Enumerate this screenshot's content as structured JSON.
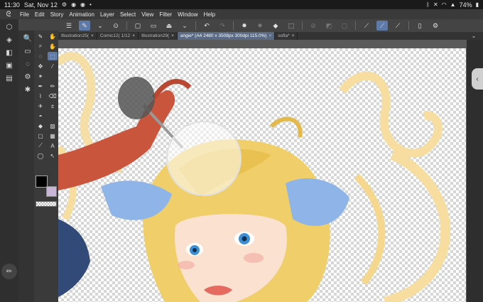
{
  "status_bar": {
    "time": "11:30",
    "date": "Sat, Nov 12",
    "battery": "74%",
    "left_icons": [
      "settings-gear-icon",
      "discord-icon",
      "discord-icon",
      "dot-icon"
    ],
    "right_icons": [
      "bluetooth-icon",
      "mute-icon",
      "wifi-icon",
      "signal-icon",
      "battery-icon"
    ]
  },
  "menu": {
    "items": [
      "File",
      "Edit",
      "Story",
      "Animation",
      "Layer",
      "Select",
      "View",
      "Filter",
      "Window",
      "Help"
    ]
  },
  "tabs": [
    {
      "label": "Illustration25(",
      "close": "×"
    },
    {
      "label": "Comic12(",
      "page": "1/12",
      "close": "×"
    },
    {
      "label": "Illustration29(",
      "close": "×"
    },
    {
      "label": "angie* (A4 2480 x 3508px 300dpi 115.0%)",
      "close": "×",
      "active": true
    },
    {
      "label": "sofia*",
      "close": "×"
    }
  ],
  "colors": {
    "main": "#000000",
    "sub": "#c9b6d6",
    "accent": "#5d7aa8"
  }
}
